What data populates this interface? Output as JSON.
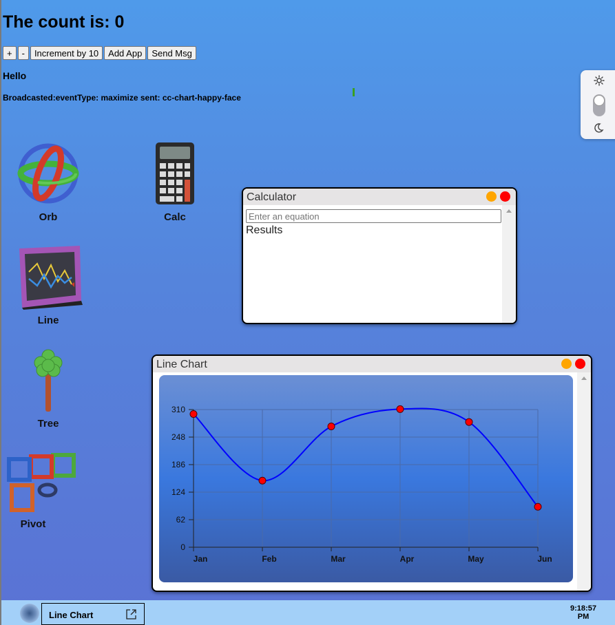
{
  "header": {
    "count_title": "The count is: 0"
  },
  "toolbar": {
    "increment_label": "+",
    "decrement_label": "-",
    "increment10_label": "Increment by 10",
    "add_app_label": "Add App",
    "send_msg_label": "Send Msg"
  },
  "messages": {
    "hello": "Hello",
    "broadcast": "Broadcasted:eventType: maximize sent: cc-chart-happy-face"
  },
  "theme_toggle": {
    "light_icon": "sun-icon",
    "dark_icon": "moon-icon",
    "mode": "light"
  },
  "desktop_icons": [
    {
      "label": "Orb",
      "icon": "orb-icon"
    },
    {
      "label": "Calc",
      "icon": "calculator-icon"
    },
    {
      "label": "Line",
      "icon": "line-chart-icon"
    },
    {
      "label": "Tree",
      "icon": "tree-icon"
    },
    {
      "label": "Pivot",
      "icon": "pivot-icon"
    }
  ],
  "calculator_window": {
    "title": "Calculator",
    "input_placeholder": "Enter an equation",
    "results_label": "Results"
  },
  "chart_window": {
    "title": "Line Chart"
  },
  "chart_data": {
    "type": "line",
    "categories": [
      "Jan",
      "Feb",
      "Mar",
      "Apr",
      "May",
      "Jun"
    ],
    "series": [
      {
        "values": [
          300,
          150,
          272,
          311,
          282,
          91
        ],
        "color": "#0000ff"
      }
    ],
    "y_ticks": [
      "0",
      "62",
      "124",
      "186",
      "248",
      "310"
    ],
    "ylim": [
      0,
      310
    ],
    "grid": true,
    "marker_color": "#ff0000"
  },
  "taskbar": {
    "items": [
      {
        "label": "Line Chart"
      }
    ],
    "clock_time": "9:18:57",
    "clock_period": "PM"
  },
  "colors": {
    "accent": "#4f9aea",
    "minimize": "#ffa500",
    "close": "#ff0000",
    "taskbar": "#a3d0f8"
  }
}
